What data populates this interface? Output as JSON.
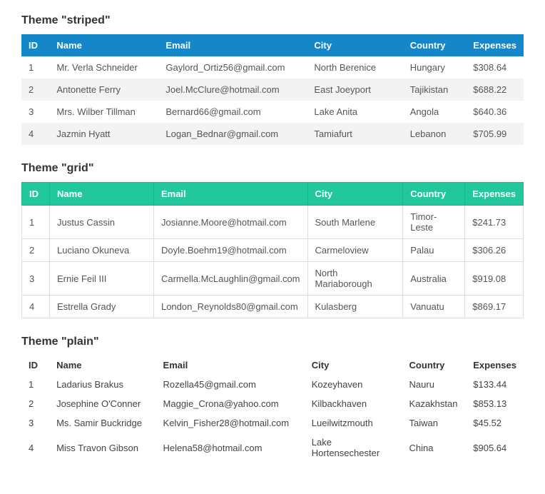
{
  "sections": [
    {
      "heading": "Theme \"striped\"",
      "themeClass": "striped",
      "columns": [
        "ID",
        "Name",
        "Email",
        "City",
        "Country",
        "Expenses"
      ],
      "rows": [
        [
          "1",
          "Mr. Verla Schneider",
          "Gaylord_Ortiz56@gmail.com",
          "North Berenice",
          "Hungary",
          "$308.64"
        ],
        [
          "2",
          "Antonette Ferry",
          "Joel.McClure@hotmail.com",
          "East Joeyport",
          "Tajikistan",
          "$688.22"
        ],
        [
          "3",
          "Mrs. Wilber Tillman",
          "Bernard66@gmail.com",
          "Lake Anita",
          "Angola",
          "$640.36"
        ],
        [
          "4",
          "Jazmin Hyatt",
          "Logan_Bednar@gmail.com",
          "Tamiafurt",
          "Lebanon",
          "$705.99"
        ]
      ]
    },
    {
      "heading": "Theme \"grid\"",
      "themeClass": "grid",
      "columns": [
        "ID",
        "Name",
        "Email",
        "City",
        "Country",
        "Expenses"
      ],
      "rows": [
        [
          "1",
          "Justus Cassin",
          "Josianne.Moore@hotmail.com",
          "South Marlene",
          "Timor-Leste",
          "$241.73"
        ],
        [
          "2",
          "Luciano Okuneva",
          "Doyle.Boehm19@hotmail.com",
          "Carmeloview",
          "Palau",
          "$306.26"
        ],
        [
          "3",
          "Ernie Feil III",
          "Carmella.McLaughlin@gmail.com",
          "North Mariaborough",
          "Australia",
          "$919.08"
        ],
        [
          "4",
          "Estrella Grady",
          "London_Reynolds80@gmail.com",
          "Kulasberg",
          "Vanuatu",
          "$869.17"
        ]
      ]
    },
    {
      "heading": "Theme \"plain\"",
      "themeClass": "plain",
      "columns": [
        "ID",
        "Name",
        "Email",
        "City",
        "Country",
        "Expenses"
      ],
      "rows": [
        [
          "1",
          "Ladarius Brakus",
          "Rozella45@gmail.com",
          "Kozeyhaven",
          "Nauru",
          "$133.44"
        ],
        [
          "2",
          "Josephine O'Conner",
          "Maggie_Crona@yahoo.com",
          "Kilbackhaven",
          "Kazakhstan",
          "$853.13"
        ],
        [
          "3",
          "Ms. Samir Buckridge",
          "Kelvin_Fisher28@hotmail.com",
          "Lueilwitzmouth",
          "Taiwan",
          "$45.52"
        ],
        [
          "4",
          "Miss Travon Gibson",
          "Helena58@hotmail.com",
          "Lake Hortensechester",
          "China",
          "$905.64"
        ]
      ]
    }
  ]
}
